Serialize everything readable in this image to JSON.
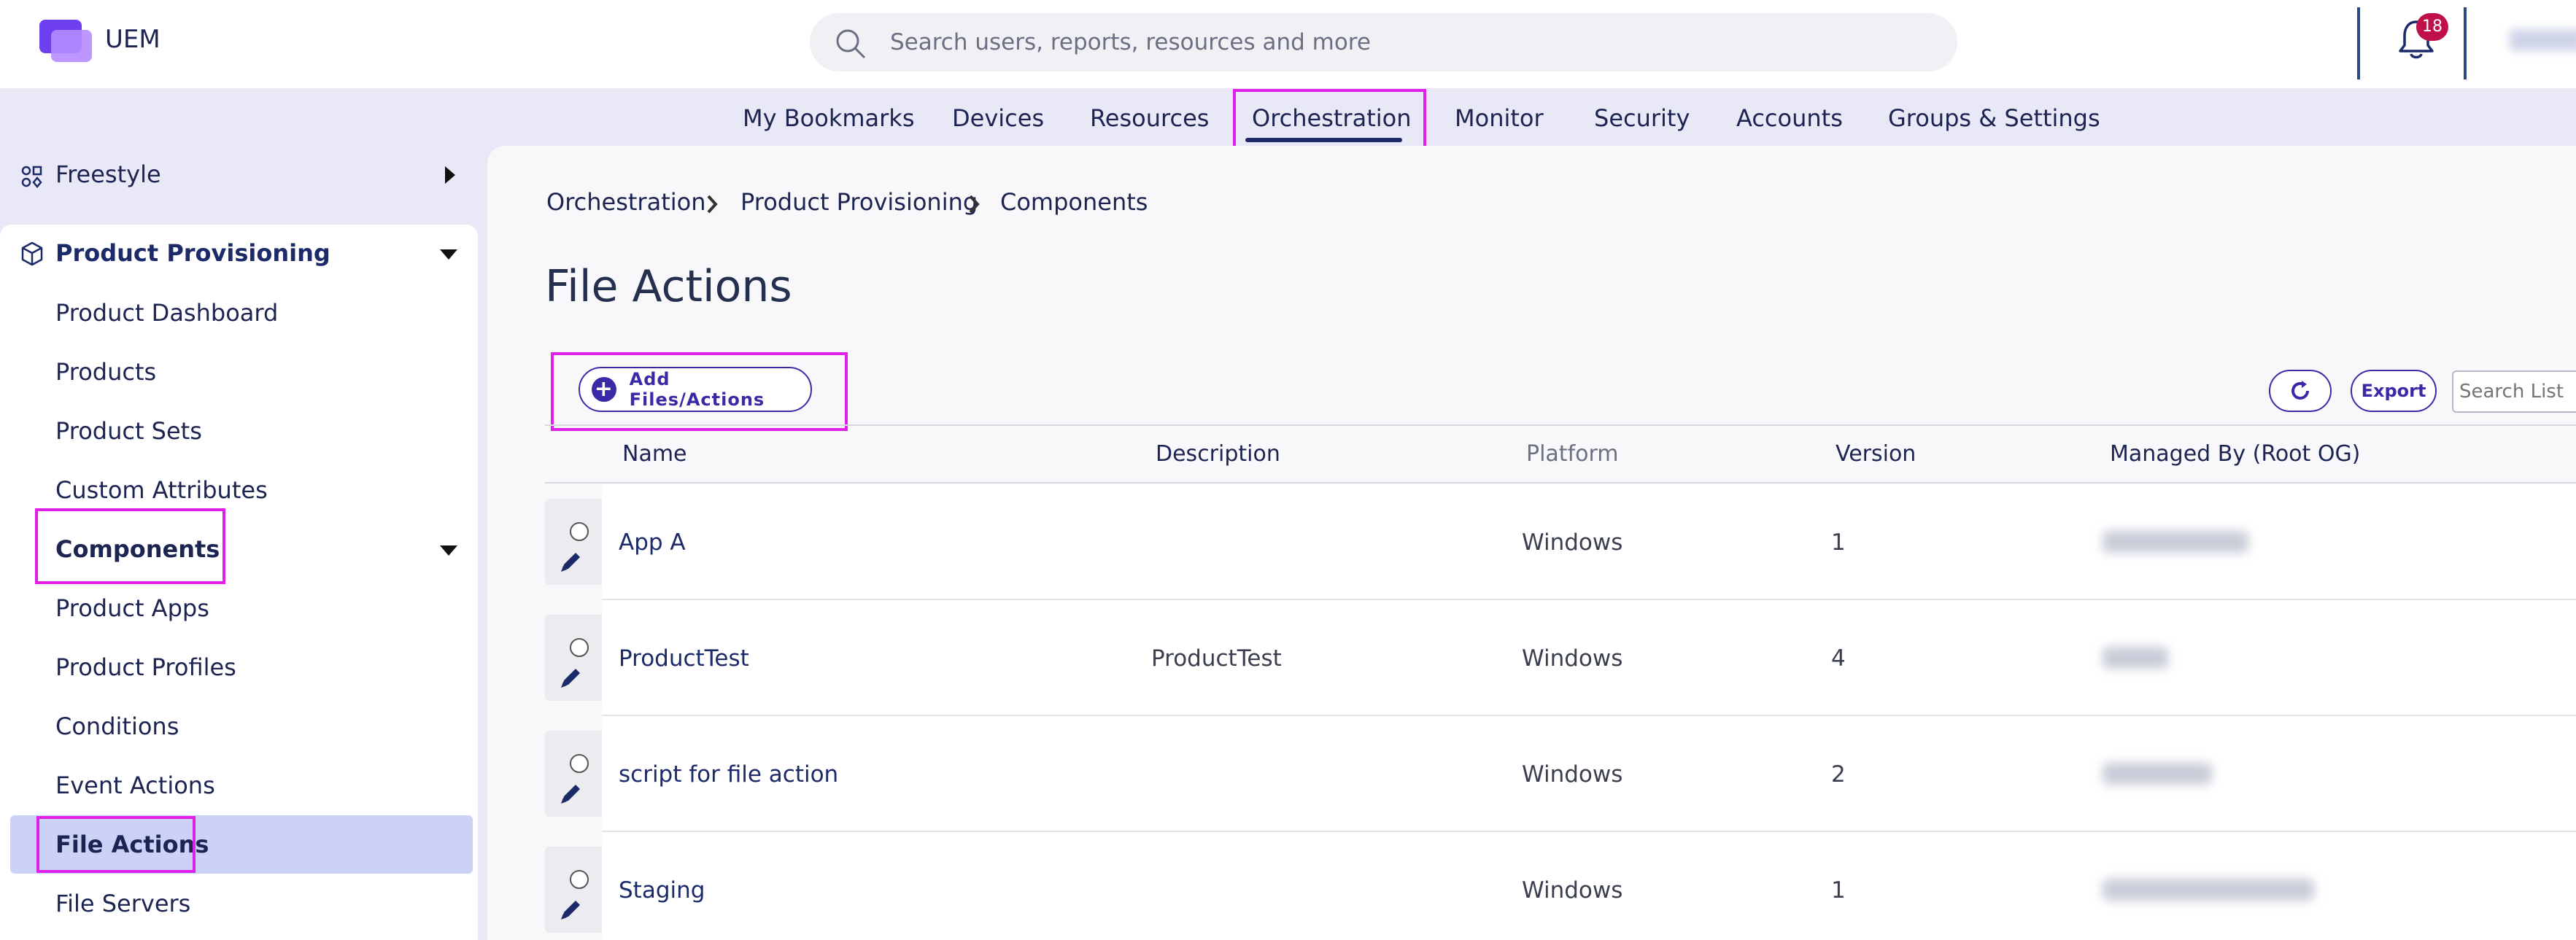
{
  "app": {
    "name": "UEM",
    "search_placeholder": "Search users, reports, resources and more",
    "notification_count": "18",
    "accent_color": "#3a2aa8",
    "highlight_color": "#e020e8"
  },
  "topnav": {
    "items": [
      "My Bookmarks",
      "Devices",
      "Resources",
      "Orchestration",
      "Monitor",
      "Security",
      "Accounts",
      "Groups & Settings"
    ],
    "active": "Orchestration"
  },
  "sidebar": {
    "freestyle": "Freestyle",
    "section": "Product Provisioning",
    "items": [
      "Product Dashboard",
      "Products",
      "Product Sets",
      "Custom Attributes",
      "Components",
      "Product Apps",
      "Product Profiles",
      "Conditions",
      "Event Actions",
      "File Actions",
      "File Servers"
    ],
    "active": "File Actions"
  },
  "breadcrumb": [
    "Orchestration",
    "Product Provisioning",
    "Components"
  ],
  "page_title": "File Actions",
  "toolbar": {
    "add_label": "Add Files/Actions",
    "export_label": "Export",
    "search_placeholder": "Search List"
  },
  "table": {
    "columns": [
      "Name",
      "Description",
      "Platform",
      "Version",
      "Managed By (Root OG)"
    ],
    "rows": [
      {
        "name": "App A",
        "description": "",
        "platform": "Windows",
        "version": "1"
      },
      {
        "name": "ProductTest",
        "description": "ProductTest",
        "platform": "Windows",
        "version": "4"
      },
      {
        "name": "script for file action",
        "description": "",
        "platform": "Windows",
        "version": "2"
      },
      {
        "name": "Staging",
        "description": "",
        "platform": "Windows",
        "version": "1"
      }
    ]
  }
}
